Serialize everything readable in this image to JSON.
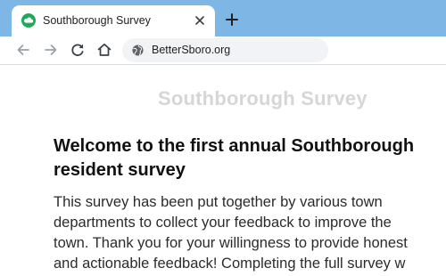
{
  "browser": {
    "tab": {
      "title": "Southborough Survey",
      "favicon": "cloud-favicon-icon",
      "close_icon": "close-icon"
    },
    "new_tab_icon": "plus-icon",
    "toolbar": {
      "back_icon": "back-arrow-icon",
      "forward_icon": "forward-arrow-icon",
      "reload_icon": "reload-icon",
      "home_icon": "home-icon",
      "site_icon": "globe-icon",
      "url": "BetterSboro.org"
    },
    "colors": {
      "tab_strip": "#7eb6e5",
      "favicon": "#1faa59"
    }
  },
  "page": {
    "site_title": "Southborough Survey",
    "heading": "Welcome to the first annual Southborough resident survey",
    "intro": "This survey has been put together by various town\ndepartments to collect your feedback to improve the\ntown. Thank you for your willingness to provide honest\nand actionable feedback!  Completing the full survey w"
  }
}
